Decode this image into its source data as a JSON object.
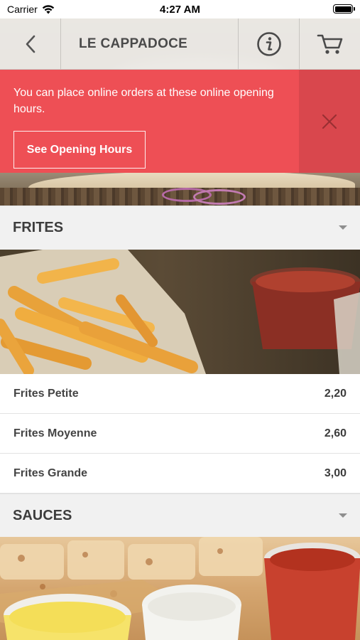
{
  "status_bar": {
    "carrier": "Carrier",
    "time": "4:27 AM"
  },
  "navbar": {
    "title": "LE CAPPADOCE",
    "icons": [
      "back-chevron-icon",
      "info-icon",
      "cart-icon"
    ]
  },
  "banner": {
    "message": "You can place online orders at these online opening hours.",
    "button_label": "See Opening Hours",
    "close_icon": "close-icon",
    "color": "#ee4f55"
  },
  "sections": [
    {
      "title": "FRITES",
      "items": [
        {
          "name": "Frites Petite",
          "price": "2,20"
        },
        {
          "name": "Frites Moyenne",
          "price": "2,60"
        },
        {
          "name": "Frites Grande",
          "price": "3,00"
        }
      ]
    },
    {
      "title": "SAUCES",
      "items": []
    }
  ]
}
